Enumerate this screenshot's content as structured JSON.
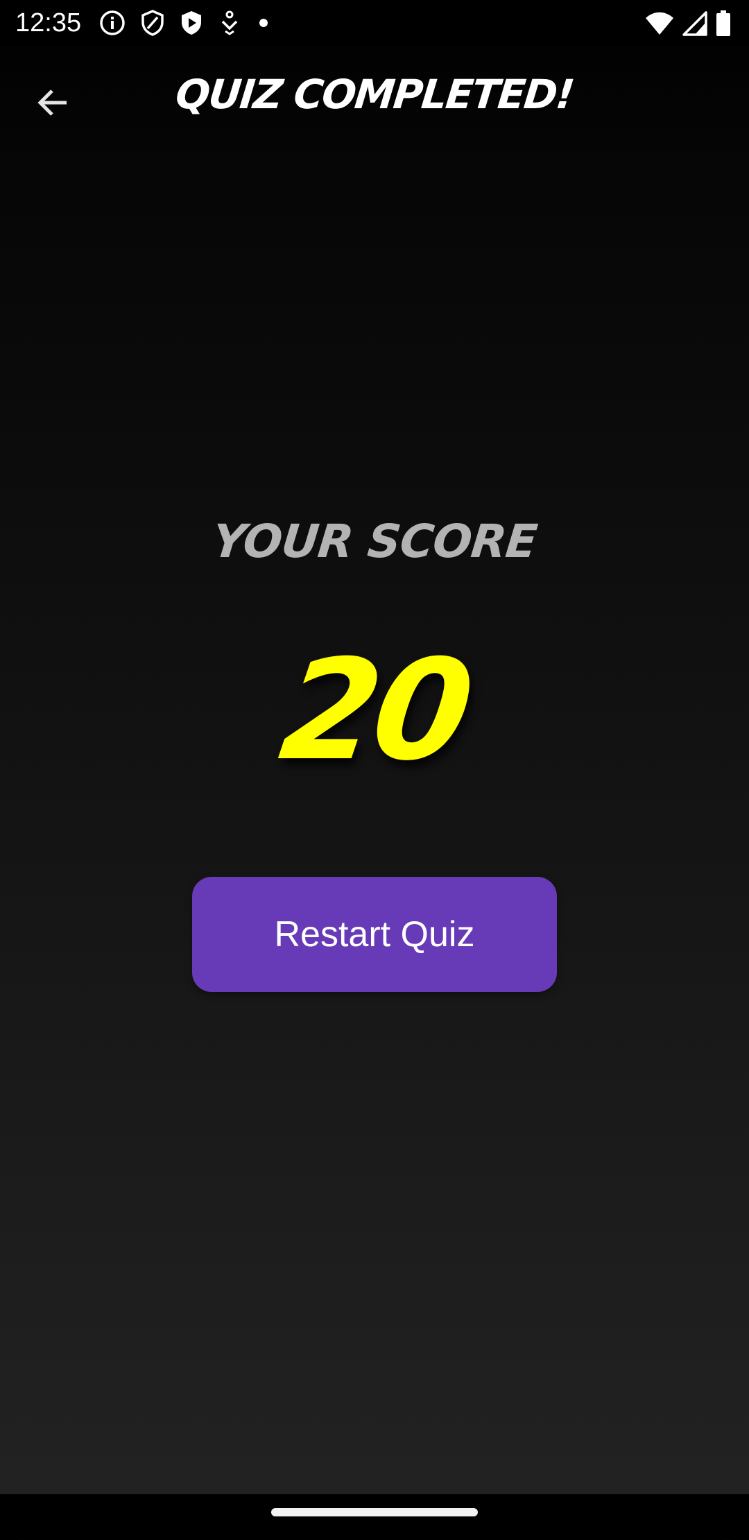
{
  "status_bar": {
    "time": "12:35",
    "left_icons": [
      "info-icon",
      "shield-icon",
      "play-shield-icon",
      "accessibility-icon",
      "dot-icon"
    ],
    "right_icons": [
      "wifi-icon",
      "signal-icon",
      "battery-icon"
    ]
  },
  "app_bar": {
    "back_icon": "arrow-left-icon",
    "title": "QUIZ COMPLETED!"
  },
  "result": {
    "label": "YOUR SCORE",
    "score": "20"
  },
  "actions": {
    "restart_label": "Restart Quiz"
  },
  "colors": {
    "score": "#ffff00",
    "label": "#b3b3b3",
    "button": "#673ab7",
    "title": "#ffffff"
  }
}
